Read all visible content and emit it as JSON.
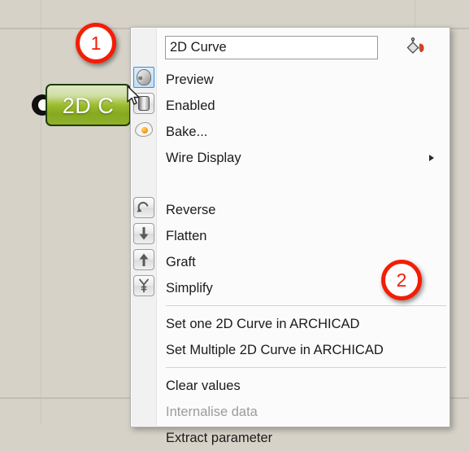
{
  "canvas": {
    "background_color": "#d6d2c8",
    "grid_color": "#cbc6bb"
  },
  "component": {
    "name": "2D Curve",
    "visible_label": "2D C",
    "body_color": "#9dbd2e",
    "border_color": "#1d3d09"
  },
  "menu": {
    "name_field": {
      "value": "2D Curve",
      "placeholder": "2D Curve"
    },
    "fill_icon": "paint-bucket-icon",
    "groups": [
      {
        "items": [
          {
            "label": "Preview",
            "icon": "preview-head-icon",
            "icon_state": "selected",
            "submenu": false,
            "disabled": false
          },
          {
            "label": "Enabled",
            "icon": "toggle-switch-icon",
            "icon_state": "framed",
            "submenu": false,
            "disabled": false
          },
          {
            "label": "Bake...",
            "icon": "bake-egg-icon",
            "icon_state": "plain",
            "submenu": false,
            "disabled": false
          },
          {
            "label": "Wire Display",
            "icon": "",
            "icon_state": "none",
            "submenu": true,
            "disabled": false
          },
          {
            "label": "Reverse",
            "icon": "reverse-icon",
            "icon_state": "framed",
            "submenu": false,
            "disabled": false
          },
          {
            "label": "Flatten",
            "icon": "flatten-arrow-down-icon",
            "icon_state": "framed",
            "submenu": false,
            "disabled": false
          },
          {
            "label": "Graft",
            "icon": "graft-arrow-up-icon",
            "icon_state": "framed",
            "submenu": false,
            "disabled": false
          },
          {
            "label": "Simplify",
            "icon": "simplify-tree-icon",
            "icon_state": "framed",
            "submenu": false,
            "disabled": false
          }
        ]
      },
      {
        "items": [
          {
            "label": "Set one 2D Curve in ARCHICAD",
            "icon": "",
            "icon_state": "none",
            "submenu": false,
            "disabled": false
          },
          {
            "label": "Set Multiple 2D Curve in ARCHICAD",
            "icon": "",
            "icon_state": "none",
            "submenu": false,
            "disabled": false
          }
        ]
      },
      {
        "items": [
          {
            "label": "Clear values",
            "icon": "",
            "icon_state": "none",
            "submenu": false,
            "disabled": false
          },
          {
            "label": "Internalise data",
            "icon": "",
            "icon_state": "none",
            "submenu": false,
            "disabled": true
          },
          {
            "label": "Extract parameter",
            "icon": "",
            "icon_state": "none",
            "submenu": false,
            "disabled": false
          }
        ]
      }
    ]
  },
  "annotations": [
    {
      "number": "1",
      "color": "#f41d05"
    },
    {
      "number": "2",
      "color": "#f41d05"
    }
  ]
}
